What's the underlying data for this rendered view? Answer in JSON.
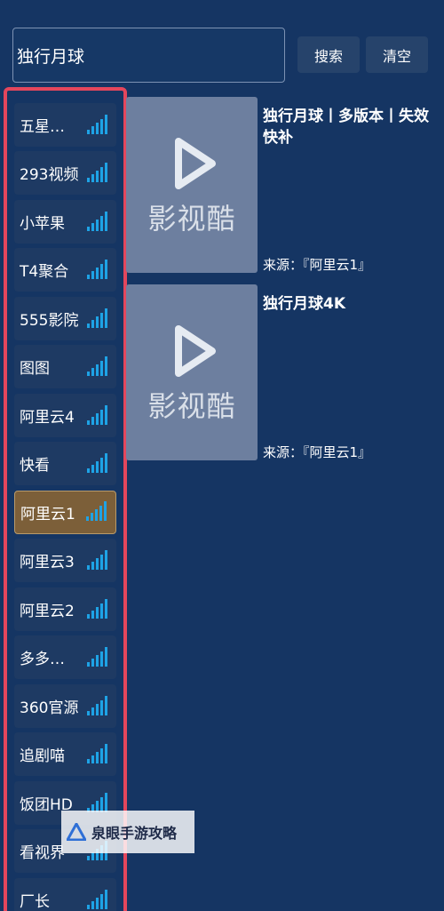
{
  "search": {
    "value": "独行月球",
    "search_label": "搜索",
    "clear_label": "清空"
  },
  "sources": [
    {
      "label": "五星…",
      "active": false
    },
    {
      "label": "293视频",
      "active": false
    },
    {
      "label": "小苹果",
      "active": false
    },
    {
      "label": "T4聚合",
      "active": false
    },
    {
      "label": "555影院",
      "active": false
    },
    {
      "label": "图图",
      "active": false
    },
    {
      "label": "阿里云4",
      "active": false
    },
    {
      "label": "快看",
      "active": false
    },
    {
      "label": "阿里云1",
      "active": true
    },
    {
      "label": "阿里云3",
      "active": false
    },
    {
      "label": "阿里云2",
      "active": false
    },
    {
      "label": "多多…",
      "active": false
    },
    {
      "label": "360官源",
      "active": false
    },
    {
      "label": "追剧喵",
      "active": false
    },
    {
      "label": "饭团HD",
      "active": false
    },
    {
      "label": "看视界",
      "active": false
    },
    {
      "label": "厂长",
      "active": false
    }
  ],
  "results": [
    {
      "title": "独行月球丨多版本丨失效快补",
      "poster_text": "影视酷",
      "source": "来源：『阿里云1』"
    },
    {
      "title": "独行月球4K",
      "poster_text": "影视酷",
      "source": "来源：『阿里云1』"
    }
  ],
  "watermark": {
    "text": "泉眼手游攻略"
  },
  "colors": {
    "background": "#153563",
    "highlight_border": "#e4465c",
    "active_item": "#7c5f39",
    "signal": "#1ea3e6"
  }
}
